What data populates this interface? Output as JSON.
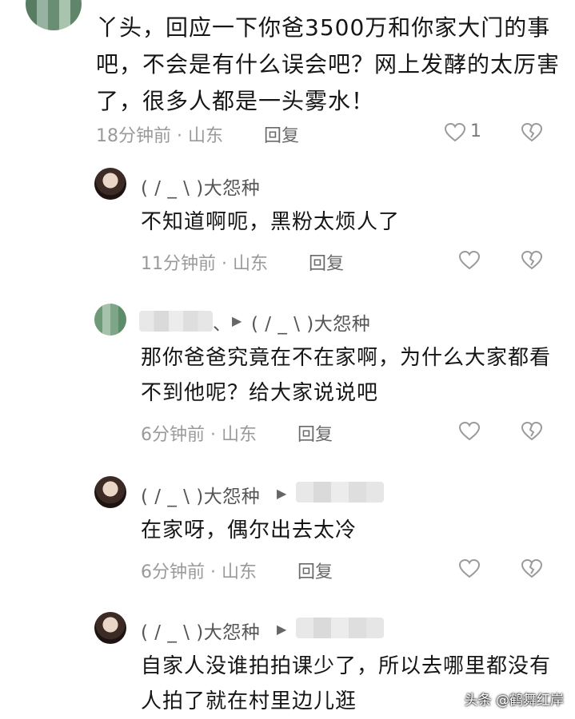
{
  "main_comment": {
    "text": "丫头，回应一下你爸3500万和你家大门的事吧，不会是有什么误会吧？网上发酵的太厉害了，很多人都是一头雾水！",
    "meta": "18分钟前 · 山东",
    "reply_label": "回复",
    "like_count": "1"
  },
  "replies": [
    {
      "user": "( / _ \\ )大怨种",
      "text": "不知道啊呃，黑粉太烦人了",
      "meta": "11分钟前 · 山东",
      "reply_label": "回复"
    },
    {
      "user": "、",
      "reply_to": "( / _ \\ )大怨种",
      "text": "那你爸爸究竟在不在家啊，为什么大家都看不到他呢？给大家说说吧",
      "meta": "6分钟前 · 山东",
      "reply_label": "回复"
    },
    {
      "user": "( / _ \\ )大怨种",
      "text": "在家呀，偶尔出去太冷",
      "meta": "6分钟前 · 山东",
      "reply_label": "回复"
    },
    {
      "user": "( / _ \\ )大怨种",
      "text": "自家人没谁拍拍课少了，所以去哪里都没有人拍了就在村里边儿逛"
    }
  ],
  "watermark": "头条 @鹤舞红岸",
  "icons": {
    "like": "heart-outline-icon",
    "dislike": "broken-heart-icon",
    "reply_arrow": "play-triangle-icon"
  }
}
